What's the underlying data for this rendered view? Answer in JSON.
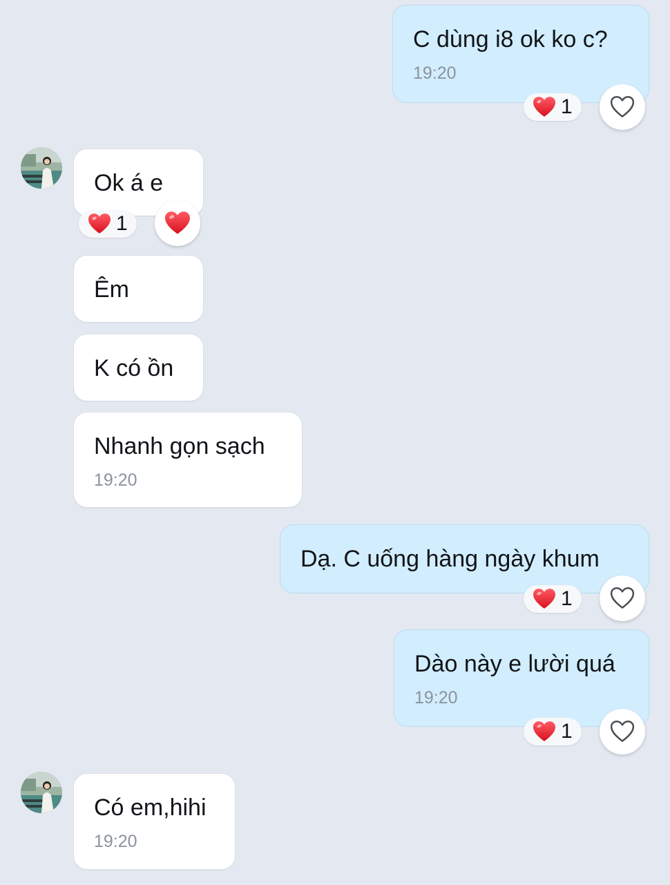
{
  "colors": {
    "background": "#e3e8f1",
    "incoming_bubble": "#ffffff",
    "outgoing_bubble": "#d2edfd",
    "heart": "#e8202f",
    "timestamp": "#8b939c"
  },
  "messages": [
    {
      "direction": "outgoing",
      "text": "C dùng i8 ok ko c?",
      "time": "19:20",
      "reaction": {
        "icon": "red-heart-icon",
        "count": "1"
      },
      "react_button": "heart-outline-icon"
    },
    {
      "direction": "incoming",
      "text": "Ok á e",
      "reaction": {
        "icon": "red-heart-icon",
        "count": "1"
      },
      "react_button": "red-heart-icon"
    },
    {
      "direction": "incoming",
      "text": "Êm"
    },
    {
      "direction": "incoming",
      "text": "K có ồn"
    },
    {
      "direction": "incoming",
      "text": "Nhanh gọn sạch",
      "time": "19:20"
    },
    {
      "direction": "outgoing",
      "text": "Dạ. C uống hàng ngày khum",
      "reaction": {
        "icon": "red-heart-icon",
        "count": "1"
      },
      "react_button": "heart-outline-icon"
    },
    {
      "direction": "outgoing",
      "text": "Dào này e lười quá",
      "time": "19:20",
      "reaction": {
        "icon": "red-heart-icon",
        "count": "1"
      },
      "react_button": "heart-outline-icon"
    },
    {
      "direction": "incoming",
      "text": "Có em,hihi",
      "time": "19:20"
    }
  ]
}
